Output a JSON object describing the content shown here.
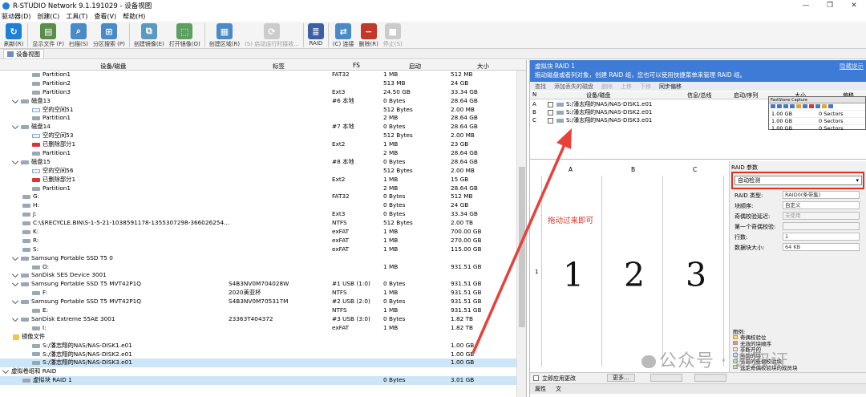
{
  "window": {
    "title": "R-STUDIO Network 9.1.191029 - 设备视图"
  },
  "menu": [
    "驱动器(D)",
    "创建(C)",
    "工具(T)",
    "查看(V)",
    "帮助(H)"
  ],
  "toolbar": [
    {
      "label": "刷新(R)",
      "icon": "refresh-icon",
      "color": "#1e7fd8",
      "enabled": true
    },
    {
      "label": "显示文件 (F)",
      "icon": "folder-icon",
      "color": "#5a8d4a",
      "enabled": true
    },
    {
      "label": "扫描(S)",
      "icon": "scan-icon",
      "color": "#4a8ac8",
      "enabled": true
    },
    {
      "label": "分区搜索 (P)",
      "icon": "partition-search-icon",
      "color": "#4a8ac8",
      "enabled": true
    },
    {
      "label": "创建镜像(E)",
      "icon": "create-image-icon",
      "color": "#5a9ac0",
      "enabled": true
    },
    {
      "label": "打开镜像(O)",
      "icon": "open-image-icon",
      "color": "#5aa060",
      "enabled": true
    },
    {
      "label": "创建区域(R)",
      "icon": "create-region-icon",
      "color": "#4a8ac8",
      "enabled": true
    },
    {
      "label": "(S) 启动运行时接收...",
      "icon": "runtime-icon",
      "color": "#cccccc",
      "enabled": false
    },
    {
      "label": "RAID",
      "icon": "raid-icon",
      "color": "#3d5fa8",
      "enabled": true
    },
    {
      "label": "(C) 连接",
      "icon": "connect-icon",
      "color": "#4a8ac8",
      "enabled": true
    },
    {
      "label": "删除(R)",
      "icon": "delete-icon",
      "color": "#c0392b",
      "enabled": true
    },
    {
      "label": "停止(S)",
      "icon": "stop-icon",
      "color": "#cccccc",
      "enabled": false
    }
  ],
  "view_tab": "设备视图",
  "columns": {
    "device": "设备/磁盘",
    "label": "标签",
    "fs": "FS",
    "start": "启动",
    "size": "大小"
  },
  "rows": [
    {
      "name": "Partition1",
      "label": "",
      "fs": "FAT32",
      "start": "1 MB",
      "size": "512 MB",
      "indent": 3,
      "icon": "part",
      "state": ""
    },
    {
      "name": "Partition2",
      "label": "",
      "fs": "",
      "start": "513 MB",
      "size": "24 GB",
      "indent": 3,
      "icon": "part",
      "state": ""
    },
    {
      "name": "Partition3",
      "label": "",
      "fs": "Ext3",
      "start": "24.50 GB",
      "size": "33.34 GB",
      "indent": 3,
      "icon": "part",
      "state": ""
    },
    {
      "name": "磁盘13",
      "label": "",
      "fs": "#6 本地",
      "start": "0 Bytes",
      "size": "28.64 GB",
      "indent": 1,
      "icon": "disk",
      "state": ""
    },
    {
      "name": "空的空间51",
      "label": "",
      "fs": "",
      "start": "512 Bytes",
      "size": "2.00 MB",
      "indent": 3,
      "icon": "empty",
      "state": ""
    },
    {
      "name": "Partition1",
      "label": "",
      "fs": "",
      "start": "2 MB",
      "size": "28.64 GB",
      "indent": 3,
      "icon": "part",
      "state": ""
    },
    {
      "name": "磁盘14",
      "label": "",
      "fs": "#7 本地",
      "start": "0 Bytes",
      "size": "28.64 GB",
      "indent": 1,
      "icon": "disk",
      "state": ""
    },
    {
      "name": "空的空间53",
      "label": "",
      "fs": "",
      "start": "512 Bytes",
      "size": "2.00 MB",
      "indent": 3,
      "icon": "empty",
      "state": ""
    },
    {
      "name": "已删除部分1",
      "label": "",
      "fs": "Ext2",
      "start": "1 MB",
      "size": "23 GB",
      "indent": 3,
      "icon": "deleted",
      "state": ""
    },
    {
      "name": "Partition1",
      "label": "",
      "fs": "",
      "start": "2 MB",
      "size": "28.64 GB",
      "indent": 3,
      "icon": "part",
      "state": ""
    },
    {
      "name": "磁盘15",
      "label": "",
      "fs": "#8 本地",
      "start": "0 Bytes",
      "size": "28.64 GB",
      "indent": 1,
      "icon": "disk",
      "state": ""
    },
    {
      "name": "空的空间56",
      "label": "",
      "fs": "",
      "start": "512 Bytes",
      "size": "2.00 MB",
      "indent": 3,
      "icon": "empty",
      "state": ""
    },
    {
      "name": "已删除部分1",
      "label": "",
      "fs": "Ext2",
      "start": "1 MB",
      "size": "15 GB",
      "indent": 3,
      "icon": "deleted",
      "state": ""
    },
    {
      "name": "Partition1",
      "label": "",
      "fs": "",
      "start": "2 MB",
      "size": "28.64 GB",
      "indent": 3,
      "icon": "part",
      "state": ""
    },
    {
      "name": "G:",
      "label": "",
      "fs": "FAT32",
      "start": "0 Bytes",
      "size": "512 MB",
      "indent": 2,
      "icon": "part",
      "state": ""
    },
    {
      "name": "H:",
      "label": "",
      "fs": "",
      "start": "0 Bytes",
      "size": "24 GB",
      "indent": 2,
      "icon": "part",
      "state": ""
    },
    {
      "name": "J:",
      "label": "",
      "fs": "Ext3",
      "start": "0 Bytes",
      "size": "33.34 GB",
      "indent": 2,
      "icon": "part",
      "state": ""
    },
    {
      "name": "C:\\$RECYCLE.BIN\\S-1-5-21-1038591178-1355307298-366026254...",
      "label": "",
      "fs": "NTFS",
      "start": "512 Bytes",
      "size": "2.00 TB",
      "indent": 2,
      "icon": "part",
      "state": ""
    },
    {
      "name": "K:",
      "label": "",
      "fs": "exFAT",
      "start": "1 MB",
      "size": "700.00 GB",
      "indent": 2,
      "icon": "part",
      "state": ""
    },
    {
      "name": "R:",
      "label": "",
      "fs": "exFAT",
      "start": "1 MB",
      "size": "270.00 GB",
      "indent": 2,
      "icon": "part",
      "state": ""
    },
    {
      "name": "S:",
      "label": "",
      "fs": "exFAT",
      "start": "1 MB",
      "size": "115.00 GB",
      "indent": 2,
      "icon": "part",
      "state": ""
    },
    {
      "name": "Samsung Portable SSD T5 0",
      "label": "",
      "fs": "",
      "start": "",
      "size": "",
      "indent": 1,
      "icon": "disk",
      "state": ""
    },
    {
      "name": "O:",
      "label": "",
      "fs": "",
      "start": "1 MB",
      "size": "931.51 GB",
      "indent": 3,
      "icon": "part",
      "state": ""
    },
    {
      "name": "SanDisk SES Device 3001",
      "label": "",
      "fs": "",
      "start": "",
      "size": "",
      "indent": 1,
      "icon": "disk",
      "state": ""
    },
    {
      "name": "Samsung Portable SSD T5 MVT42P1Q",
      "label": "S4B3NV0M704028W",
      "fs": "#1 USB (1:0)",
      "start": "0 Bytes",
      "size": "931.51 GB",
      "indent": 1,
      "icon": "disk",
      "state": ""
    },
    {
      "name": "F:",
      "label": "2020美亚杯",
      "fs": "NTFS",
      "start": "1 MB",
      "size": "931.51 GB",
      "indent": 3,
      "icon": "part",
      "state": ""
    },
    {
      "name": "Samsung Portable SSD T5 MVT42P1Q",
      "label": "S4B3NV0M705317M",
      "fs": "#2 USB (2:0)",
      "start": "0 Bytes",
      "size": "931.51 GB",
      "indent": 1,
      "icon": "disk",
      "state": ""
    },
    {
      "name": "E:",
      "label": "",
      "fs": "NTFS",
      "start": "1 MB",
      "size": "931.51 GB",
      "indent": 3,
      "icon": "part",
      "state": ""
    },
    {
      "name": "SanDisk Extreme 55AE 3001",
      "label": "23363T404372",
      "fs": "#3 USB (3:0)",
      "start": "0 Bytes",
      "size": "1.82 TB",
      "indent": 1,
      "icon": "disk",
      "state": ""
    },
    {
      "name": "I:",
      "label": "",
      "fs": "exFAT",
      "start": "1 MB",
      "size": "1.82 TB",
      "indent": 3,
      "icon": "part",
      "state": ""
    },
    {
      "name": "镜像文件",
      "label": "",
      "fs": "",
      "start": "",
      "size": "",
      "indent": 1,
      "icon": "folder",
      "state": ""
    },
    {
      "name": "S:/潘志翔的NAS/NAS-DISK1.e01",
      "label": "",
      "fs": "",
      "start": "",
      "size": "1.00 GB",
      "indent": 3,
      "icon": "part",
      "state": ""
    },
    {
      "name": "S:/潘志翔的NAS/NAS-DISK2.e01",
      "label": "",
      "fs": "",
      "start": "",
      "size": "1.00 GB",
      "indent": 3,
      "icon": "part",
      "state": ""
    },
    {
      "name": "S:/潘志翔的NAS/NAS-DISK3.e01",
      "label": "",
      "fs": "",
      "start": "",
      "size": "1.00 GB",
      "indent": 3,
      "icon": "part",
      "state": "sel"
    },
    {
      "name": "虚拟卷组和 RAID",
      "label": "",
      "fs": "",
      "start": "",
      "size": "",
      "indent": 0,
      "icon": "none",
      "state": ""
    },
    {
      "name": "虚拟块 RAID 1",
      "label": "",
      "fs": "",
      "start": "0 Bytes",
      "size": "3.01 GB",
      "indent": 2,
      "icon": "raid",
      "state": "sel"
    }
  ],
  "raid_panel": {
    "header_title": "虚拟块 RAID 1",
    "header_desc": "拖动磁盘或者列对象，创建 RAID 组，您也可以使用快捷菜单来管理 RAID 组。",
    "hide_link": "隐藏提示",
    "tabs": [
      {
        "label": "查找",
        "state": "normal"
      },
      {
        "label": "添加丢失的磁盘",
        "state": "normal"
      },
      {
        "label": "删除",
        "state": "dis"
      },
      {
        "label": "上移",
        "state": "dis"
      },
      {
        "label": "下移",
        "state": "dis"
      },
      {
        "label": "同步偏移",
        "state": "act"
      }
    ],
    "table_cols": {
      "n": "N",
      "disk": "设备/磁盘",
      "info": "信息/总线",
      "start": "启动/序列",
      "size": "大小",
      "offset": "偏移"
    },
    "disks": [
      {
        "n": "A",
        "name": "S:/潘志翔的NAS/NAS-DISK1.e01",
        "size": "1.00 GB",
        "offset": "0 Sectors"
      },
      {
        "n": "B",
        "name": "S:/潘志翔的NAS/NAS-DISK2.e01",
        "size": "1.00 GB",
        "offset": "0 Sectors"
      },
      {
        "n": "C",
        "name": "S:/潘志翔的NAS/NAS-DISK3.e01",
        "size": "1.00 GB",
        "offset": "0 Sectors"
      }
    ],
    "overlay_title": "FastStone Capture",
    "grid_cols": [
      "A",
      "B",
      "C"
    ],
    "grid_row": "1",
    "grid_nums": [
      "1",
      "2",
      "3"
    ],
    "hint_text": "拖动过来即可",
    "params": {
      "title": "RAID 参数",
      "auto": "自动检测",
      "raid_type_label": "RAID 类型:",
      "raid_type": "RAID0(条带集)",
      "block_order_label": "块顺序:",
      "block_order": "自定义",
      "parity_delay_label": "奇偶校验延迟:",
      "parity_delay": "未使用",
      "first_parity_label": "第一个奇偶校验:",
      "first_parity": "",
      "rows_label": "行数:",
      "rows": "1",
      "block_size_label": "数据块大小:",
      "block_size": "64 KB"
    },
    "legend_title": "图例:",
    "legend": [
      {
        "label": "奇偶校验位",
        "color": "#f6e05e"
      },
      {
        "label": "无效的块顺序",
        "color": "#f28b82"
      },
      {
        "label": "非断开的",
        "color": "#fbe7c6"
      },
      {
        "label": "当前的块",
        "color": "#c6e0ff"
      },
      {
        "label": "当前的奇偶校验块",
        "color": "#a8e6a3"
      },
      {
        "label": "选定奇偶校验块的成员块",
        "color": "#ffd09e"
      }
    ],
    "apply_now": "立即应用更改",
    "more_btn": "更多...",
    "bottom_tabs": [
      "属性",
      "文"
    ]
  },
  "watermark": "公众号 · 谢取证"
}
